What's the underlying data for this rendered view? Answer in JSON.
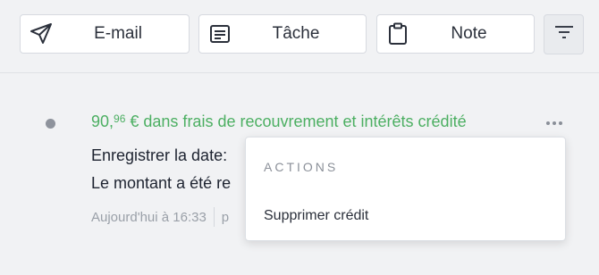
{
  "toolbar": {
    "email": {
      "label": "E-mail",
      "icon": "send-icon"
    },
    "task": {
      "label": "Tâche",
      "icon": "task-icon"
    },
    "note": {
      "label": "Note",
      "icon": "clipboard-icon"
    },
    "filter": {
      "icon": "filter-icon"
    }
  },
  "entry": {
    "title_amount_main": "90,",
    "title_amount_cents": "96",
    "title_rest": " € dans frais de recouvrement et intérêts crédité",
    "line1": "Enregistrer la date: ",
    "line2": "Le montant a été re",
    "timestamp": "Aujourd'hui à 16:33",
    "meta_tail": "p",
    "title_color": "#4caf62"
  },
  "actions_menu": {
    "heading": "ACTIONS",
    "items": [
      {
        "label": "Supprimer crédit"
      }
    ]
  }
}
